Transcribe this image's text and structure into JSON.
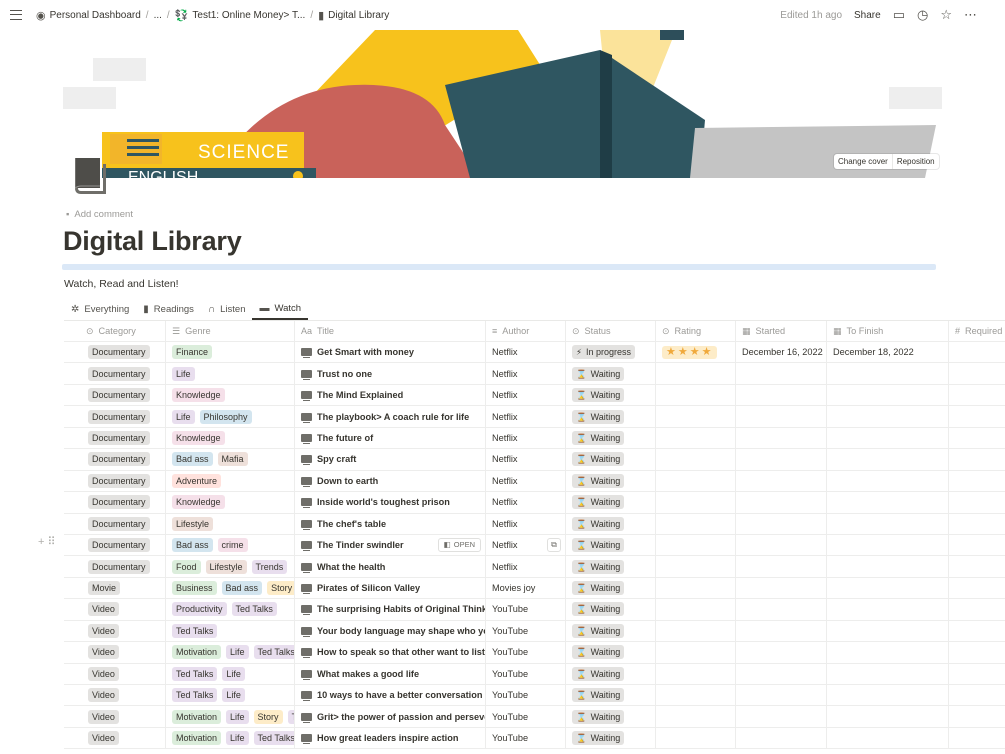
{
  "topbar": {
    "breadcrumbs": [
      {
        "icon": "person-circle-icon",
        "label": "Personal Dashboard"
      },
      {
        "icon": "",
        "label": "..."
      },
      {
        "icon": "money-icon",
        "label": "Test1: Online Money> T..."
      },
      {
        "icon": "book-icon",
        "label": "Digital Library"
      }
    ],
    "edited": "Edited 1h ago",
    "share": "Share"
  },
  "cover": {
    "change_cover": "Change cover",
    "reposition": "Reposition",
    "book_labels": [
      "SCIENCE",
      "ENGLISH"
    ]
  },
  "page": {
    "add_comment": "Add comment",
    "title": "Digital Library",
    "subtitle": "Watch, Read and Listen!"
  },
  "tabs": [
    {
      "icon": "gear-icon",
      "label": "Everything"
    },
    {
      "icon": "book-icon",
      "label": "Readings"
    },
    {
      "icon": "headphones-icon",
      "label": "Listen"
    },
    {
      "icon": "monitor-icon",
      "label": "Watch",
      "active": true
    }
  ],
  "columns": {
    "category": "Category",
    "genre": "Genre",
    "title": "Title",
    "author": "Author",
    "status": "Status",
    "rating": "Rating",
    "started": "Started",
    "finish": "To Finish",
    "required": "Required"
  },
  "row_buttons": {
    "open": "OPEN"
  },
  "tag_colors": {
    "Finance": "green",
    "Life": "purple",
    "Knowledge": "pink",
    "Philosophy": "blue",
    "Bad ass": "blue",
    "Mafia": "brown",
    "Adventure": "red",
    "Lifestyle": "brown",
    "crime": "pink",
    "Food": "green",
    "Trends": "purple",
    "Business": "green",
    "Story": "yellow",
    "Productivity": "purple",
    "Ted Talks": "purple",
    "Motivation": "green"
  },
  "rows": [
    {
      "category": "Documentary",
      "genre": [
        "Finance"
      ],
      "title": "Get Smart with money",
      "author": "Netflix",
      "status": "In progress",
      "status_icon": "⚡",
      "rating": "★★★★",
      "started": "December 16, 2022",
      "finish": "December 18, 2022"
    },
    {
      "category": "Documentary",
      "genre": [
        "Life"
      ],
      "title": "Trust no one",
      "author": "Netflix",
      "status": "Waiting",
      "status_icon": "⌛"
    },
    {
      "category": "Documentary",
      "genre": [
        "Knowledge"
      ],
      "title": "The Mind Explained",
      "author": "Netflix",
      "status": "Waiting",
      "status_icon": "⌛"
    },
    {
      "category": "Documentary",
      "genre": [
        "Life",
        "Philosophy"
      ],
      "title": "The playbook> A coach rule for life",
      "author": "Netflix",
      "status": "Waiting",
      "status_icon": "⌛"
    },
    {
      "category": "Documentary",
      "genre": [
        "Knowledge"
      ],
      "title": "The future of",
      "author": "Netflix",
      "status": "Waiting",
      "status_icon": "⌛"
    },
    {
      "category": "Documentary",
      "genre": [
        "Bad ass",
        "Mafia"
      ],
      "title": "Spy craft",
      "author": "Netflix",
      "status": "Waiting",
      "status_icon": "⌛"
    },
    {
      "category": "Documentary",
      "genre": [
        "Adventure"
      ],
      "title": "Down to earth",
      "author": "Netflix",
      "status": "Waiting",
      "status_icon": "⌛"
    },
    {
      "category": "Documentary",
      "genre": [
        "Knowledge"
      ],
      "title": "Inside world's toughest prison",
      "author": "Netflix",
      "status": "Waiting",
      "status_icon": "⌛"
    },
    {
      "category": "Documentary",
      "genre": [
        "Lifestyle"
      ],
      "title": "The chef's table",
      "author": "Netflix",
      "status": "Waiting",
      "status_icon": "⌛"
    },
    {
      "category": "Documentary",
      "genre": [
        "Bad ass",
        "crime"
      ],
      "title": "The Tinder swindler",
      "author": "Netflix",
      "status": "Waiting",
      "status_icon": "⌛",
      "hover": true
    },
    {
      "category": "Documentary",
      "genre": [
        "Food",
        "Lifestyle",
        "Trends"
      ],
      "title": "What the health",
      "author": "Netflix",
      "status": "Waiting",
      "status_icon": "⌛"
    },
    {
      "category": "Movie",
      "genre": [
        "Business",
        "Bad ass",
        "Story"
      ],
      "title": "Pirates of Silicon Valley",
      "author": "Movies joy",
      "status": "Waiting",
      "status_icon": "⌛"
    },
    {
      "category": "Video",
      "genre": [
        "Productivity",
        "Ted Talks"
      ],
      "title": "The surprising Habits of Original Thinkers",
      "author": "YouTube",
      "status": "Waiting",
      "status_icon": "⌛"
    },
    {
      "category": "Video",
      "genre": [
        "Ted Talks"
      ],
      "title": "Your body language may shape who you",
      "author": "YouTube",
      "status": "Waiting",
      "status_icon": "⌛"
    },
    {
      "category": "Video",
      "genre": [
        "Motivation",
        "Life",
        "Ted Talks"
      ],
      "title": "How to speak so that other want to listen",
      "author": "YouTube",
      "status": "Waiting",
      "status_icon": "⌛"
    },
    {
      "category": "Video",
      "genre": [
        "Ted Talks",
        "Life"
      ],
      "title": "What makes a good life",
      "author": "YouTube",
      "status": "Waiting",
      "status_icon": "⌛"
    },
    {
      "category": "Video",
      "genre": [
        "Ted Talks",
        "Life"
      ],
      "title": "10 ways to have a better conversation",
      "author": "YouTube",
      "status": "Waiting",
      "status_icon": "⌛"
    },
    {
      "category": "Video",
      "genre": [
        "Motivation",
        "Life",
        "Story",
        "Ted Talks"
      ],
      "title": "Grit> the power of passion and perseverance",
      "author": "YouTube",
      "status": "Waiting",
      "status_icon": "⌛"
    },
    {
      "category": "Video",
      "genre": [
        "Motivation",
        "Life",
        "Ted Talks"
      ],
      "title": "How great leaders inspire action",
      "author": "YouTube",
      "status": "Waiting",
      "status_icon": "⌛"
    }
  ]
}
